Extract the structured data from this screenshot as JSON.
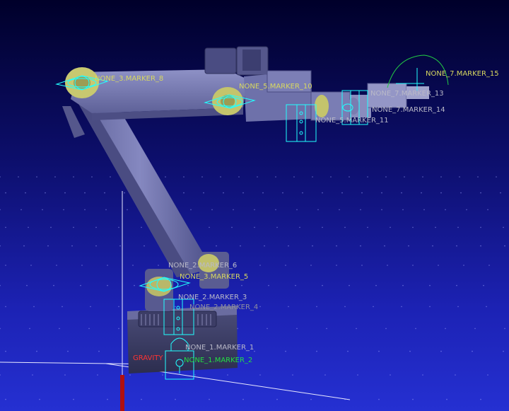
{
  "colors": {
    "background_top": "#00002a",
    "background_bottom": "#2530d2",
    "robot_body": "#7f82b8",
    "robot_shadow": "#44467a",
    "joint_yellow": "#c8c864",
    "marker_cyan": "#22ffff",
    "label_yellow": "#d8d860",
    "label_grey": "#b9b9c8",
    "label_green": "#22dd44",
    "label_red": "#ff3333"
  },
  "labels": {
    "none3_marker8": "NONE_3.MARKER_8",
    "none5_marker10": "NONE_5.MARKER_10",
    "none7_marker15": "NONE_7.MARKER_15",
    "none7_marker13": "NONE_7.MARKER_13",
    "none7_marker14": "NONE_7.MARKER_14",
    "none_marker11": "NONE_5.MARKER_11",
    "none2_marker6": "NONE_2.MARKER_6",
    "none3_marker5": "NONE_3.MARKER_5",
    "none2_marker3": "NONE_2.MARKER_3",
    "marker4": "NONE_2.MARKER_4",
    "none1_marker1": "NONE_1.MARKER_1",
    "marker2": "NONE_1.MARKER_2",
    "gravity": "GRAVITY"
  },
  "icons": {
    "ground_lock": "lock-icon",
    "ground_marker": "ground-icon",
    "joint_markers": "revolute-joint-icon",
    "gripper_marker": "motion-icon"
  }
}
